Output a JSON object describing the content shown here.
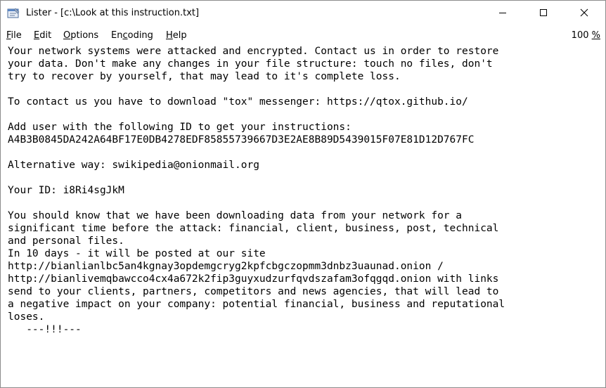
{
  "window": {
    "title": "Lister - [c:\\Look at this instruction.txt]",
    "app_icon": "notepad-document-icon",
    "controls": {
      "minimize_icon": "minimize-icon",
      "maximize_icon": "maximize-icon",
      "close_icon": "close-icon"
    }
  },
  "menu": {
    "file": {
      "first": "F",
      "rest": "ile"
    },
    "edit": {
      "first": "E",
      "rest": "dit"
    },
    "options": {
      "first": "O",
      "rest": "ptions"
    },
    "encoding": {
      "pre": "En",
      "under": "c",
      "rest": "oding"
    },
    "help": {
      "first": "H",
      "rest": "elp"
    },
    "zoom": {
      "number": "100",
      "percent": "%"
    }
  },
  "document": {
    "text": "Your network systems were attacked and encrypted. Contact us in order to restore\nyour data. Don't make any changes in your file structure: touch no files, don't\ntry to recover by yourself, that may lead to it's complete loss.\n\nTo contact us you have to download \"tox\" messenger: https://qtox.github.io/\n\nAdd user with the following ID to get your instructions:\nA4B3B0845DA242A64BF17E0DB4278EDF85855739667D3E2AE8B89D5439015F07E81D12D767FC\n\nAlternative way: swikipedia@onionmail.org\n\nYour ID: i8Ri4sgJkM\n\nYou should know that we have been downloading data from your network for a\nsignificant time before the attack: financial, client, business, post, technical\nand personal files.\nIn 10 days - it will be posted at our site\nhttp://bianlianlbc5an4kgnay3opdemgcryg2kpfcbgczopmm3dnbz3uaunad.onion /\nhttp://bianlivemqbawcco4cx4a672k2fip3guyxudzurfqvdszafam3ofqgqd.onion with links\nsend to your clients, partners, competitors and news agencies, that will lead to\na negative impact on your company: potential financial, business and reputational\nloses.\n   ---!!!---"
  }
}
